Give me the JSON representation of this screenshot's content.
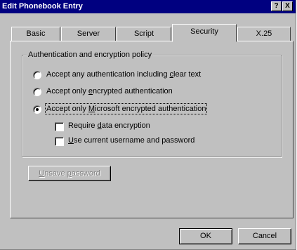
{
  "window": {
    "title": "Edit Phonebook Entry",
    "help_label": "?",
    "close_label": "X"
  },
  "tabs": [
    {
      "label": "Basic",
      "active": false
    },
    {
      "label": "Server",
      "active": false
    },
    {
      "label": "Script",
      "active": false
    },
    {
      "label": "Security",
      "active": true
    },
    {
      "label": "X.25",
      "active": false
    }
  ],
  "security": {
    "group_label": "Authentication and encryption policy",
    "options": [
      {
        "pre": "Accept any authentication including ",
        "key": "c",
        "post": "lear text",
        "selected": false
      },
      {
        "pre": "Accept only ",
        "key": "e",
        "post": "ncrypted authentication",
        "selected": false
      },
      {
        "pre": "Accept only ",
        "key": "M",
        "post": "icrosoft encrypted authentication",
        "selected": true
      }
    ],
    "checkboxes": [
      {
        "pre": "Require ",
        "key": "d",
        "post": "ata encryption",
        "checked": false
      },
      {
        "pre": "",
        "key": "U",
        "post": "se current username and password",
        "checked": false
      }
    ],
    "unsave_button": {
      "pre": "",
      "key": "U",
      "mid": "nsave ",
      "key2": "p",
      "post": "assword"
    }
  },
  "footer": {
    "ok_label": "OK",
    "cancel_label": "Cancel"
  }
}
